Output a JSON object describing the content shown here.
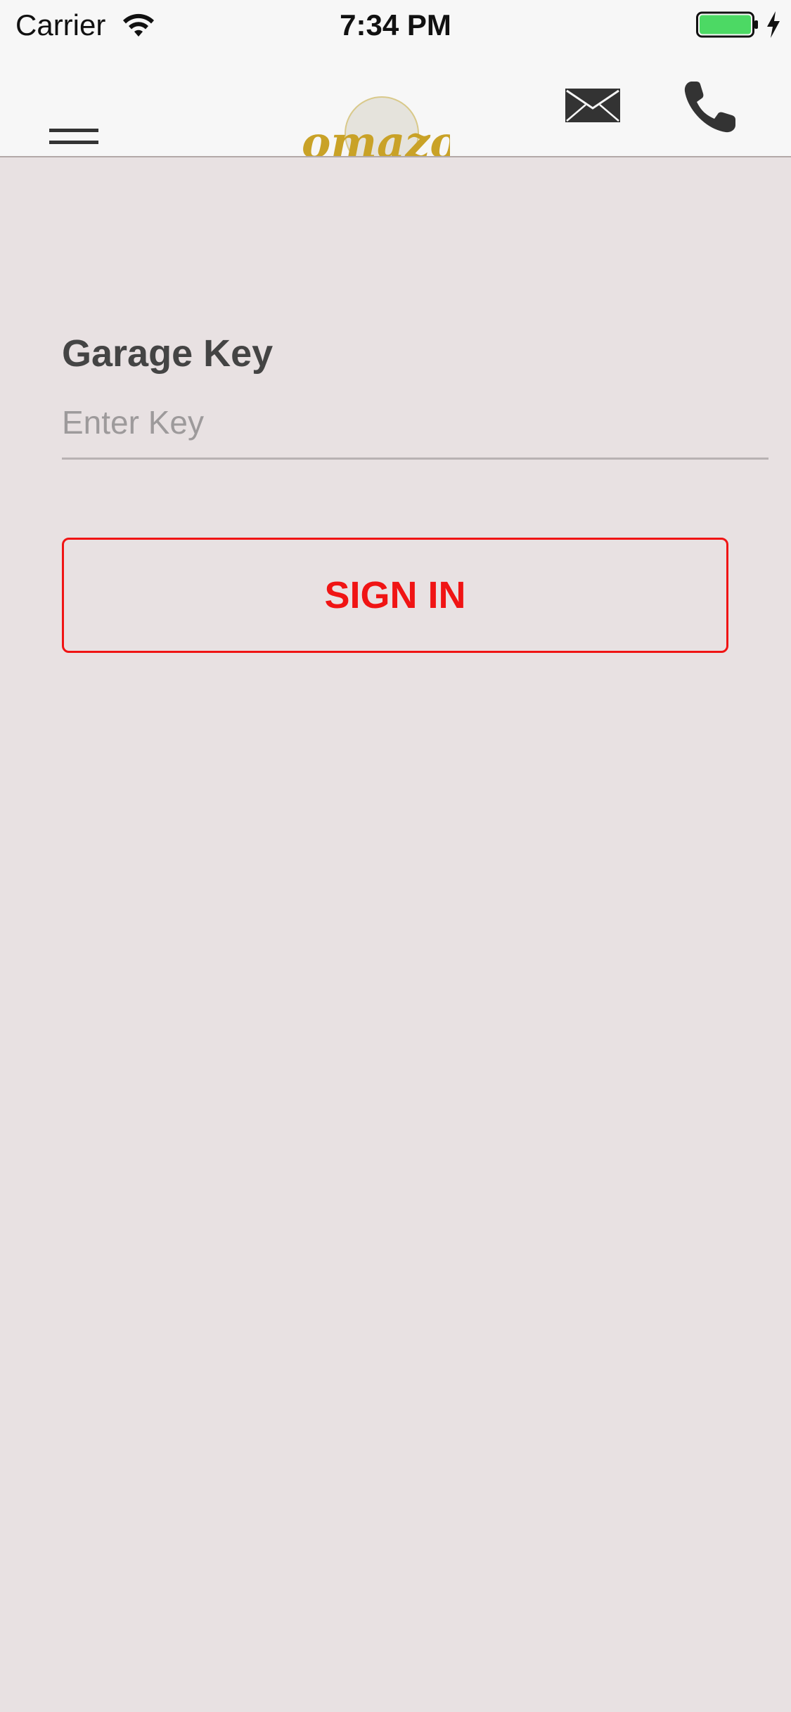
{
  "status_bar": {
    "carrier": "Carrier",
    "time": "7:34 PM"
  },
  "nav": {
    "logo_text": "omazon",
    "icons": [
      "menu-icon",
      "mail-icon",
      "phone-icon"
    ]
  },
  "form": {
    "label": "Garage Key",
    "key_placeholder": "Enter Key",
    "key_value": "",
    "signin_label": "SIGN IN"
  },
  "colors": {
    "background": "#e8e1e2",
    "bar": "#f7f7f7",
    "accent_red": "#f01414",
    "battery_green": "#4cd964",
    "logo_gold": "#c9a227"
  }
}
